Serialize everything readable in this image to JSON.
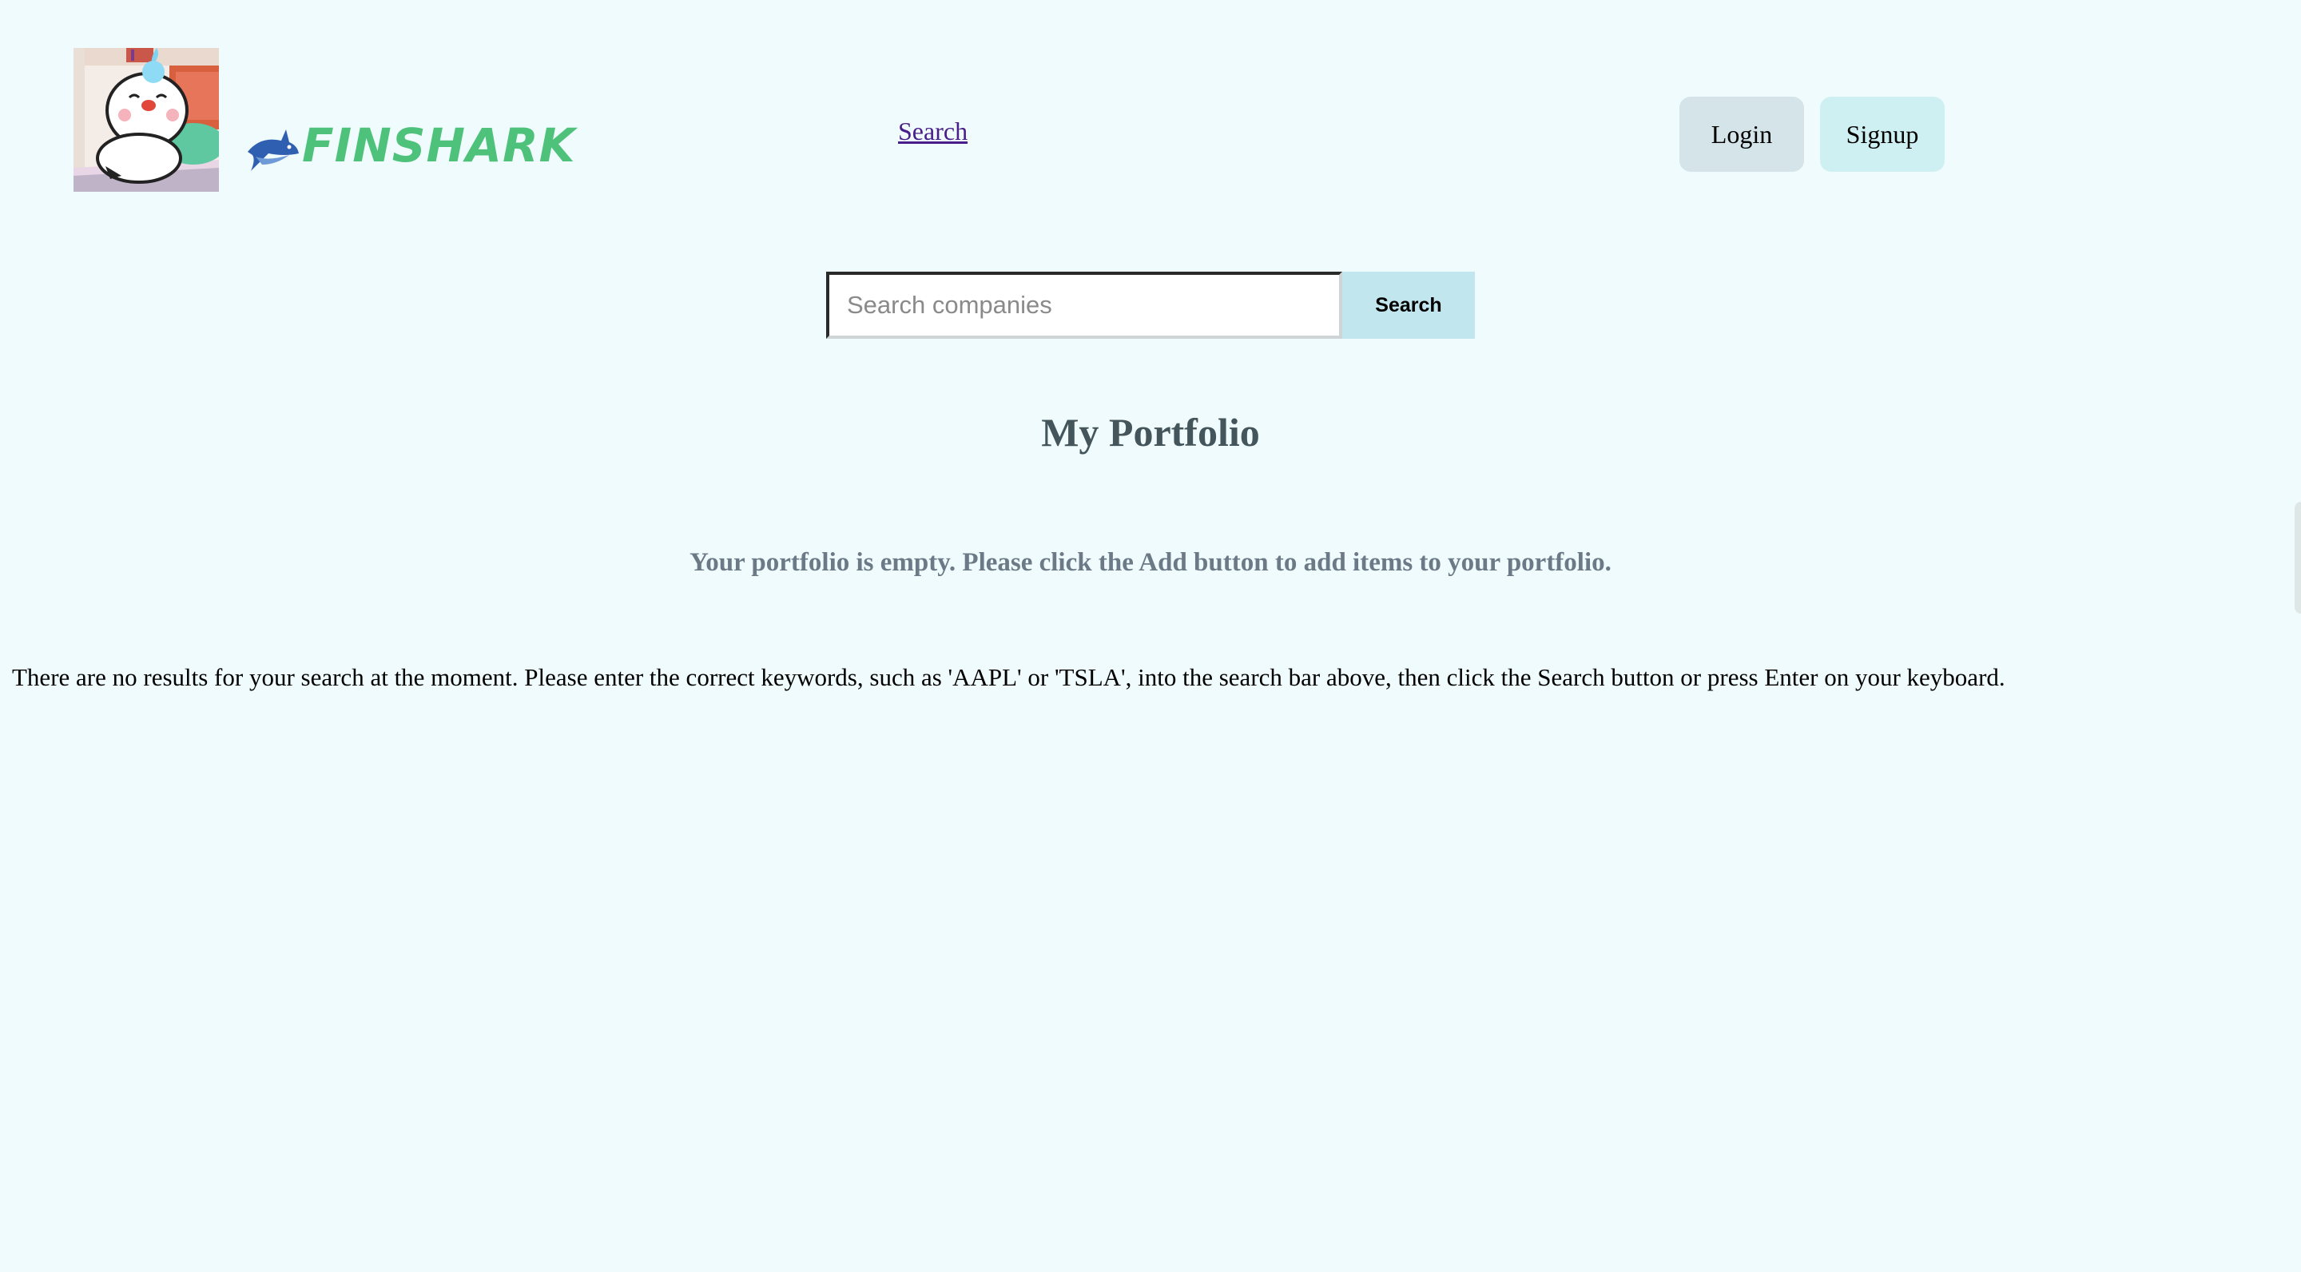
{
  "header": {
    "avatar_alt": "sleeping cartoon avatar",
    "logo_text": "FINSHARK",
    "nav_search_label": "Search",
    "login_label": "Login",
    "signup_label": "Signup"
  },
  "search": {
    "placeholder": "Search companies",
    "value": "",
    "button_label": "Search"
  },
  "portfolio": {
    "title": "My Portfolio",
    "empty_message": "Your portfolio is empty. Please click the Add button to add items to your portfolio."
  },
  "results": {
    "empty_message": "There are no results for your search at the moment. Please enter the correct keywords, such as 'AAPL' or 'TSLA', into the search bar above, then click the Search button or press Enter on your keyboard."
  },
  "colors": {
    "background": "#effbfc",
    "logo_green": "#4ec27a",
    "shark_blue": "#2f5fb0",
    "login_bg": "#d4e4e9",
    "signup_bg": "#cef0f2",
    "search_button_bg": "#c1e6ed",
    "title_color": "#44555b"
  },
  "icons": {
    "logo_mark": "shark-icon",
    "avatar": "avatar-image"
  }
}
